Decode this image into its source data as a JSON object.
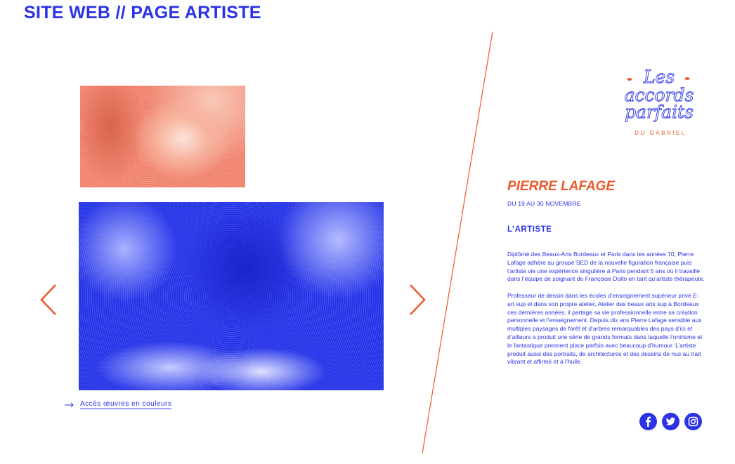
{
  "header": {
    "title": "SITE WEB // PAGE ARTISTE"
  },
  "gallery": {
    "small_image_label": "Photo arbre orange",
    "main_image_label": "Photo arbre bleu",
    "colour_link": "Accès œuvres en couleurs"
  },
  "logo": {
    "line1": "Les",
    "line2": "accords",
    "line3": "parfaits",
    "line4": "DU GABRIEL"
  },
  "artist": {
    "name": "PIERRE LAFAGE",
    "dates": "DU 19 AU 30 NOVEMBRE",
    "section_heading": "L’ARTISTE",
    "bio_p1": "Diplômé des Beaux-Arts Bordeaux et Paris dans les années 70, Pierre Lafage adhère au groupe SED de la nouvelle figuration française puis l’artiste vie une expérience singulière à Paris pendant 5 ans où il travaille dans l’équipe de soignant de Françoise Dolto en tant qu’artiste thérapeute.",
    "bio_p2": "Professeur de dessin dans les écoles d’enseignement supérieur privé E-art sup et dans son propre atelier, Atelier des beaux arts sup à Bordeaux ces dernières années, il partage sa vie professionnelle entre sa création personnelle et l’enseignement. Depuis dix ans Pierre Lafage sensible aux multiples paysages de forêt et d’arbres remarquables des pays d’ici et d’ailleurs a produit une série de grands formats dans laquelle l’onirisme et le fantastique prennent place parfois avec beaucoup d’humour. L’artiste produit aussi des portraits, de architectures et des dessins de nus au trait vibrant et affirmé et à l’huile."
  },
  "social": [
    "facebook-icon",
    "twitter-icon",
    "instagram-icon"
  ],
  "colors": {
    "blue": "#2b33e6",
    "orange": "#ec5a28",
    "salmon": "#f0826c"
  }
}
